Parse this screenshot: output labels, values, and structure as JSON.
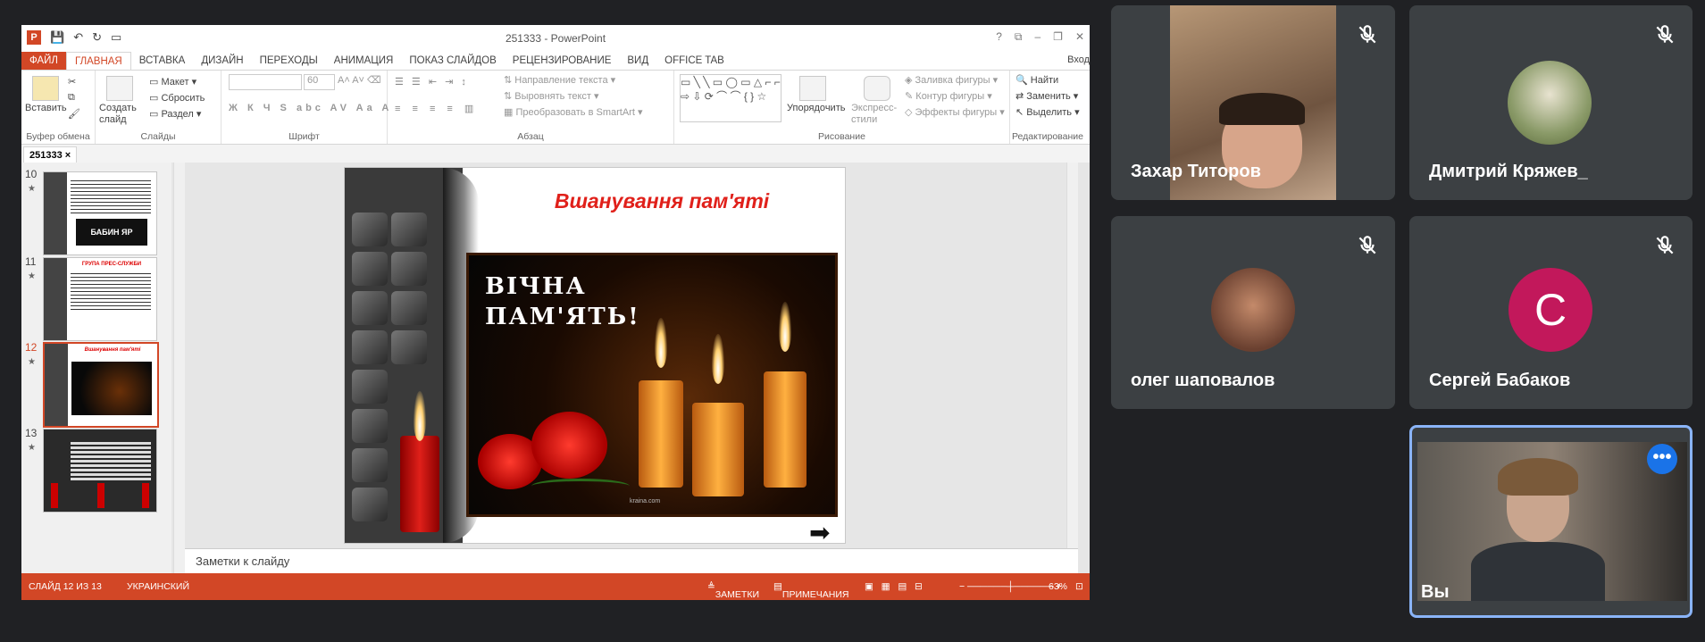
{
  "ppt": {
    "window_title": "251333 - PowerPoint",
    "tabs": [
      "ФАЙЛ",
      "ГЛАВНАЯ",
      "ВСТАВКА",
      "ДИЗАЙН",
      "ПЕРЕХОДЫ",
      "АНИМАЦИЯ",
      "ПОКАЗ СЛАЙДОВ",
      "РЕЦЕНЗИРОВАНИЕ",
      "ВИД",
      "OFFICE TAB"
    ],
    "login": "Вход",
    "ribbon": {
      "paste": "Вставить",
      "create_slide": "Создать слайд",
      "layout": "Макет",
      "reset": "Сбросить",
      "section": "Раздел",
      "font_size": "60",
      "text_direction": "Направление текста",
      "align_text": "Выровнять текст",
      "convert_smartart": "Преобразовать в SmartArt",
      "arrange": "Упорядочить",
      "quick_styles": "Экспресс-стили",
      "shape_fill": "Заливка фигуры",
      "shape_outline": "Контур фигуры",
      "shape_effects": "Эффекты фигуры",
      "find": "Найти",
      "replace": "Заменить",
      "select": "Выделить",
      "groups": {
        "clipboard": "Буфер обмена",
        "slides": "Слайды",
        "font": "Шрифт",
        "paragraph": "Абзац",
        "drawing": "Рисование",
        "editing": "Редактирование"
      }
    },
    "doc_tab": "251333",
    "thumbnails": [
      {
        "num": "10",
        "caption": "БАБИН ЯР"
      },
      {
        "num": "11",
        "caption": "ГРУПА ПРЕС-СЛУЖБИ"
      },
      {
        "num": "12",
        "caption": "Вшанування пам'яті"
      },
      {
        "num": "13",
        "caption": ""
      }
    ],
    "slide": {
      "title": "Вшанування пам'яті",
      "photo_line1": "ВІЧНА",
      "photo_line2": "ПАМ'ЯТЬ!",
      "watermark": "kraina.com"
    },
    "notes_placeholder": "Заметки к слайду",
    "status": {
      "slide_counter": "СЛАЙД 12 ИЗ 13",
      "language": "УКРАИНСКИЙ",
      "notes": "ЗАМЕТКИ",
      "comments": "ПРИМЕЧАНИЯ",
      "zoom": "63%"
    }
  },
  "meet": {
    "participants": [
      {
        "name": "Захар Титоров"
      },
      {
        "name": "Дмитрий Кряжев_"
      },
      {
        "name": "олег шаповалов"
      },
      {
        "name": "Сергей Бабаков",
        "initial": "С"
      },
      {
        "name": "Вы"
      }
    ],
    "colors": {
      "tile": "#3c4043",
      "avatar_c": "#c2185b",
      "accent": "#8ab4f8",
      "more": "#1a73e8"
    }
  }
}
